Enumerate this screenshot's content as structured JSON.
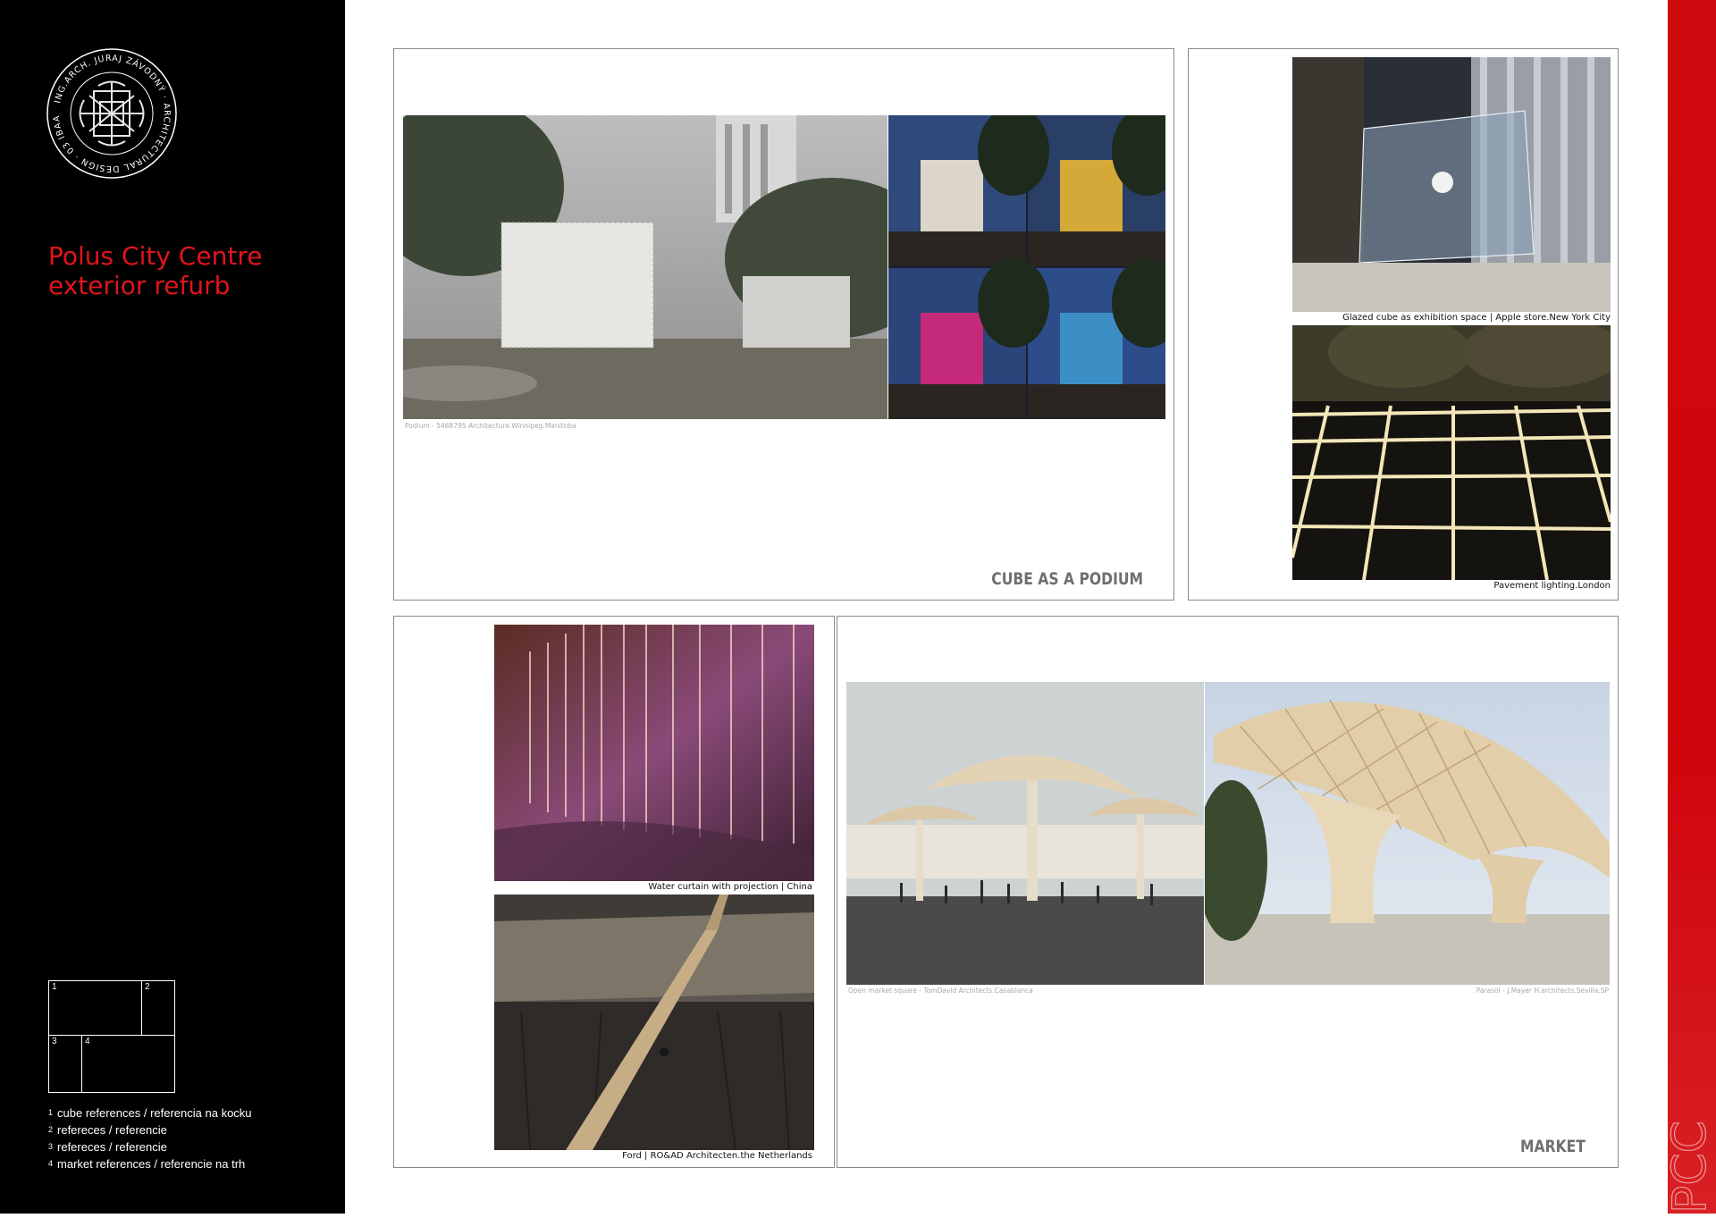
{
  "brand": {
    "logo_ring_text": "ING.ARCH. JURAJ ZÁVODNÝ · ARCHITECTURAL DESIGN · 03 IBAA 1004",
    "logo_icon": "knot-emblem-icon",
    "side_mark": "PCC"
  },
  "project": {
    "title_line1": "Polus City Centre",
    "title_line2": "exterior refurb"
  },
  "legend": {
    "grid_labels": [
      "1",
      "2",
      "3",
      "4"
    ],
    "items": [
      {
        "num": "1",
        "text": "cube references / referencia na kocku"
      },
      {
        "num": "2",
        "text": "refereces / referencie"
      },
      {
        "num": "3",
        "text": "refereces / referencie"
      },
      {
        "num": "4",
        "text": "market references / referencie na trh"
      }
    ]
  },
  "panels": {
    "cube": {
      "title": "CUBE AS A PODIUM",
      "caption_main": "Podium - 5468795 Architecture.Winnipeg.Manitoba"
    },
    "references2": {
      "caption_apple": "Glazed cube as exhibition space | Apple store.New York City",
      "caption_pavement": "Pavement lighting.London"
    },
    "references3": {
      "caption_water": "Water curtain with projection | China",
      "caption_ford": "Ford | RO&AD Architecten.the Netherlands"
    },
    "market": {
      "title": "MARKET",
      "caption_left": "Open market square - TomDavid Architects.Casablanca",
      "caption_right": "Parasol - J.Mayer H.architects.Sevilla.SP"
    }
  },
  "colors": {
    "accent_red": "#e1141c",
    "sidebar": "#000000",
    "panel_border": "#8a8a8a",
    "title_grey": "#6f6f6f"
  }
}
